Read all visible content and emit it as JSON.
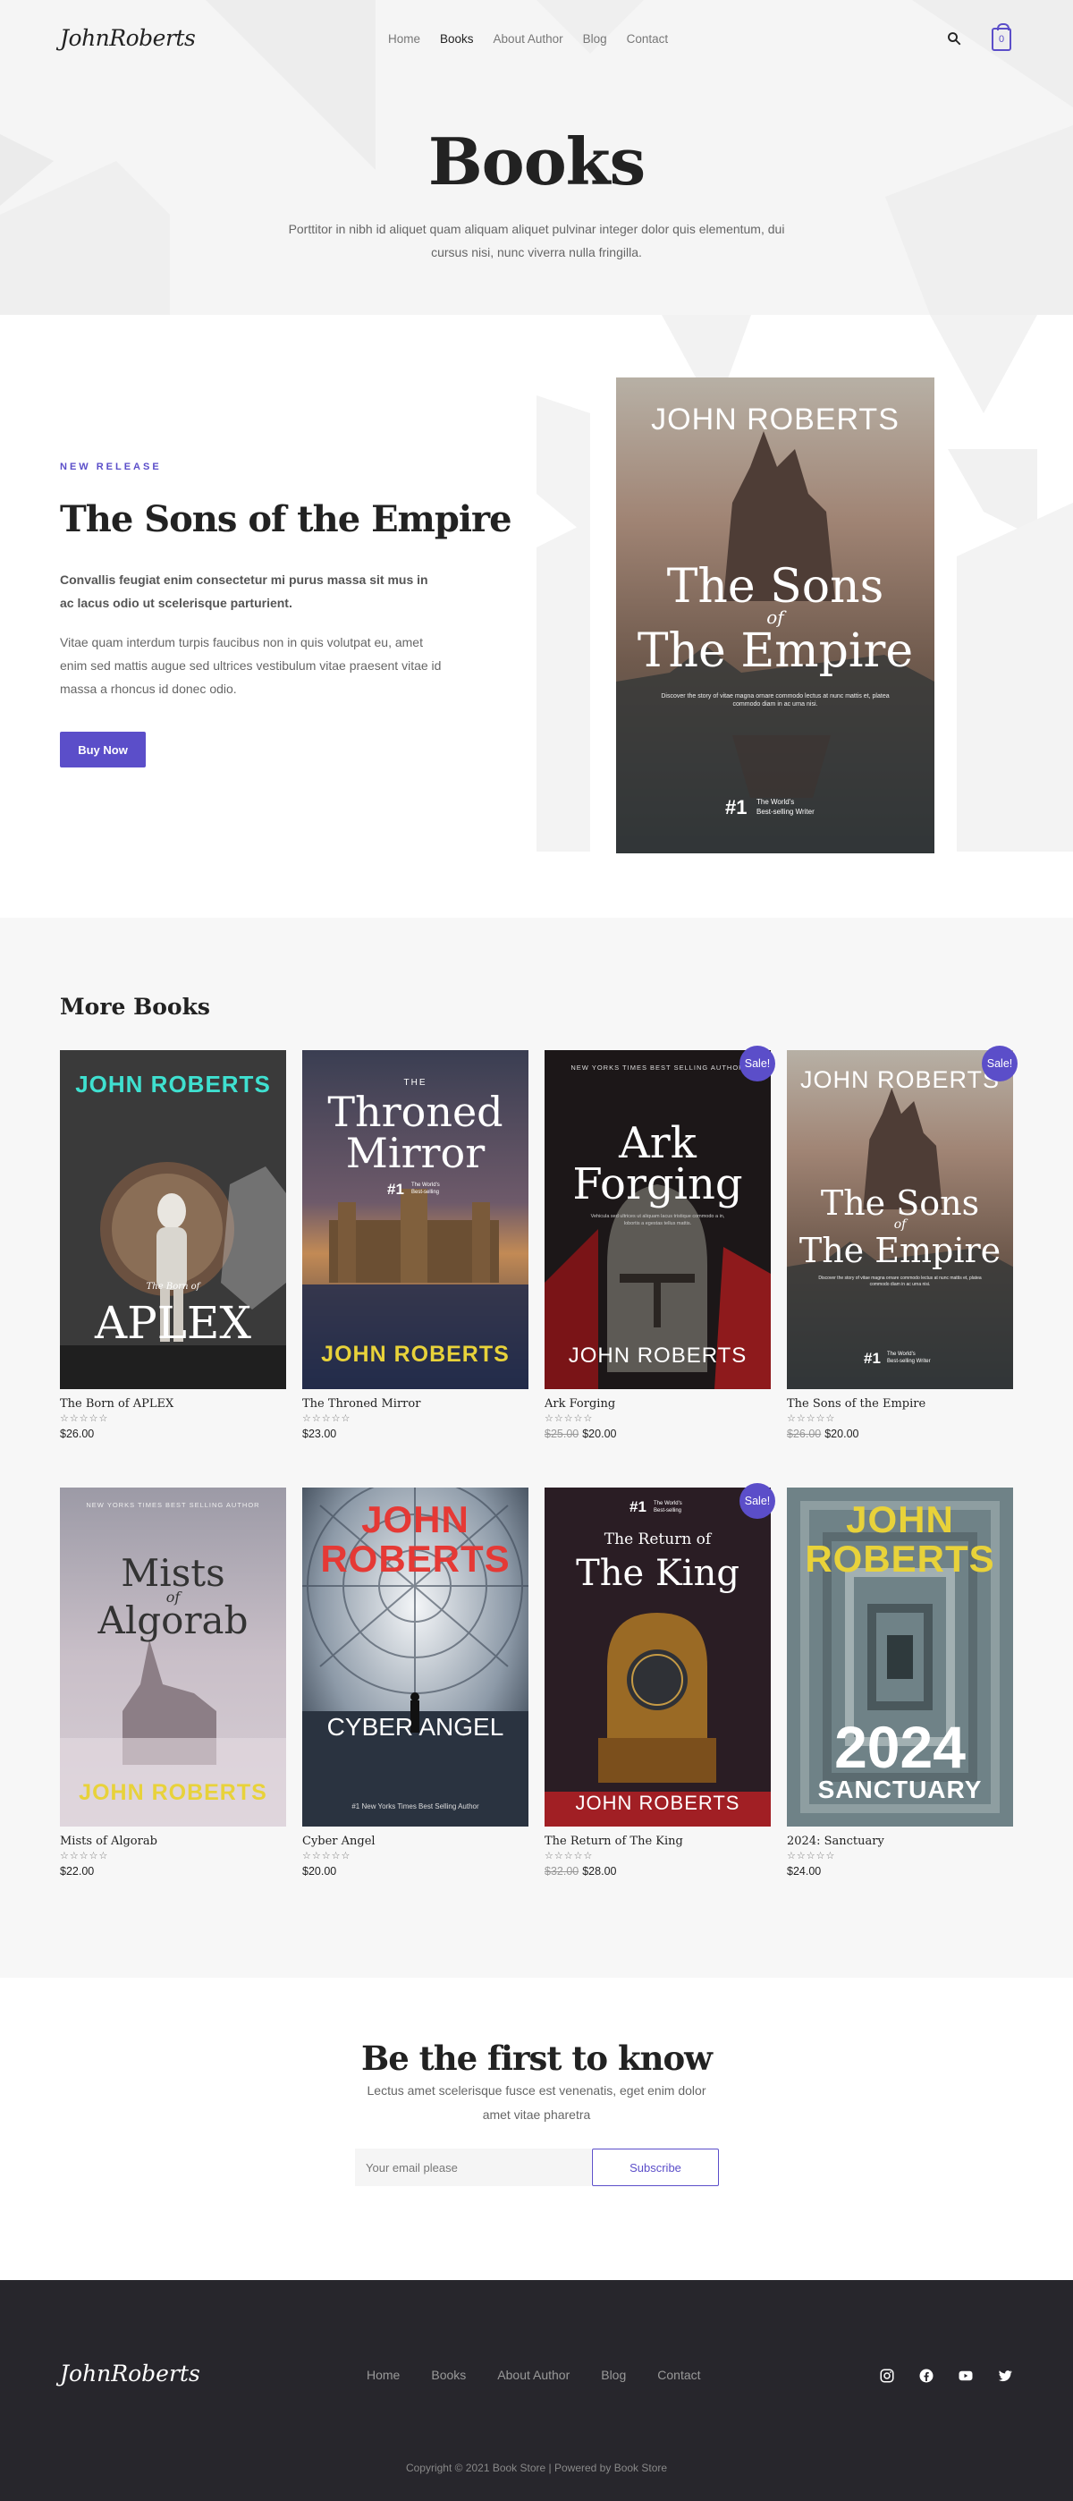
{
  "brand": {
    "logo": "JohnRoberts"
  },
  "nav": {
    "items": [
      "Home",
      "Books",
      "About Author",
      "Blog",
      "Contact"
    ],
    "active": "Books"
  },
  "cart": {
    "count": "0"
  },
  "page": {
    "title": "Books",
    "description": "Porttitor in nibh id aliquet quam aliquam aliquet pulvinar integer dolor quis elementum, dui cursus nisi, nunc viverra nulla fringilla."
  },
  "hero": {
    "tag": "NEW RELEASE",
    "title": "The Sons of the Empire",
    "bold_text": "Convallis feugiat enim consectetur mi purus massa sit mus in ac lacus odio ut scelerisque parturient.",
    "text": "Vitae quam interdum turpis faucibus non in quis volutpat eu, amet enim sed mattis augue sed ultrices vestibulum vitae praesent vitae id massa a rhoncus id donec odio.",
    "button": "Buy Now",
    "cover": {
      "author": "JOHN ROBERTS",
      "title_line1": "The Sons",
      "title_of": "of",
      "title_line2": "The Empire",
      "blurb": "Discover the story of vitae magna ornare commodo lectus at nunc mattis et, platea commodo diam in ac urna nisi.",
      "rank": "#1",
      "rank_text_1": "The World's",
      "rank_text_2": "Best-selling Writer"
    }
  },
  "more_books": {
    "title": "More Books",
    "sale_label": "Sale!",
    "stars": "☆☆☆☆☆",
    "products": [
      {
        "name": "The Born of APLEX",
        "price": "$26.00",
        "old_price": "",
        "sale": false,
        "cover": {
          "author": "JOHN ROBERTS",
          "small": "The Born of",
          "title": "APLEX",
          "author_color": "#3fe0d0"
        }
      },
      {
        "name": "The Throned Mirror",
        "price": "$23.00",
        "old_price": "",
        "sale": false,
        "cover": {
          "top": "THE",
          "title1": "Throned",
          "title2": "Mirror",
          "rank": "#1",
          "rank_text_1": "The World's",
          "rank_text_2": "Best-selling",
          "author": "JOHN ROBERTS",
          "author_color": "#e8d23a"
        }
      },
      {
        "name": "Ark Forging",
        "price": "$20.00",
        "old_price": "$25.00",
        "sale": true,
        "cover": {
          "top": "NEW YORKS TIMES BEST SELLING AUTHOR",
          "title1": "Ark",
          "title2": "Forging",
          "blurb": "Vehicula sed ultrices ut aliquam lacus tristique commodo a in, lobortis a egestas tellus mattis.",
          "author": "JOHN ROBERTS"
        }
      },
      {
        "name": "The Sons of the Empire",
        "price": "$20.00",
        "old_price": "$26.00",
        "sale": true,
        "cover": {
          "author": "JOHN ROBERTS",
          "title1": "The Sons",
          "of": "of",
          "title2": "The Empire",
          "blurb": "Discover the story of vitae magna ornare commodo lectus at nunc mattis et, platea commodo diam in ac urna nisi.",
          "rank": "#1",
          "rank_text_1": "The World's",
          "rank_text_2": "Best-selling Writer"
        }
      },
      {
        "name": "Mists of Algorab",
        "price": "$22.00",
        "old_price": "",
        "sale": false,
        "cover": {
          "top": "NEW YORKS TIMES BEST SELLING AUTHOR",
          "title1": "Mists",
          "of": "of",
          "title2": "Algorab",
          "author": "JOHN ROBERTS",
          "author_color": "#e8d23a"
        }
      },
      {
        "name": "Cyber Angel",
        "price": "$20.00",
        "old_price": "",
        "sale": false,
        "cover": {
          "author1": "JOHN",
          "author2": "ROBERTS",
          "title": "CYBER ANGEL",
          "bottom": "#1 New Yorks Times Best Selling Author",
          "author_color": "#e53935"
        }
      },
      {
        "name": "The Return of The King",
        "price": "$28.00",
        "old_price": "$32.00",
        "sale": true,
        "cover": {
          "rank": "#1",
          "rank_text_1": "The World's",
          "rank_text_2": "Best-selling",
          "title_small": "The Return of",
          "title": "The King",
          "author": "JOHN ROBERTS"
        }
      },
      {
        "name": "2024: Sanctuary",
        "price": "$24.00",
        "old_price": "",
        "sale": false,
        "cover": {
          "author1": "JOHN",
          "author2": "ROBERTS",
          "year": "2024",
          "title": "SANCTUARY",
          "author_color": "#e8d23a"
        }
      }
    ]
  },
  "newsletter": {
    "title": "Be the first to know",
    "description": "Lectus amet scelerisque fusce est venenatis, eget enim dolor amet vitae pharetra",
    "placeholder": "Your email please",
    "button": "Subscribe"
  },
  "footer": {
    "logo": "JohnRoberts",
    "nav": [
      "Home",
      "Books",
      "About Author",
      "Blog",
      "Contact"
    ],
    "social": [
      "instagram-icon",
      "facebook-icon",
      "youtube-icon",
      "twitter-icon"
    ],
    "copyright": "Copyright © 2021 Book Store | Powered by Book Store"
  },
  "colors": {
    "accent": "#5b4ec9",
    "footer_bg": "#27262c",
    "section_bg": "#f7f7f7"
  }
}
